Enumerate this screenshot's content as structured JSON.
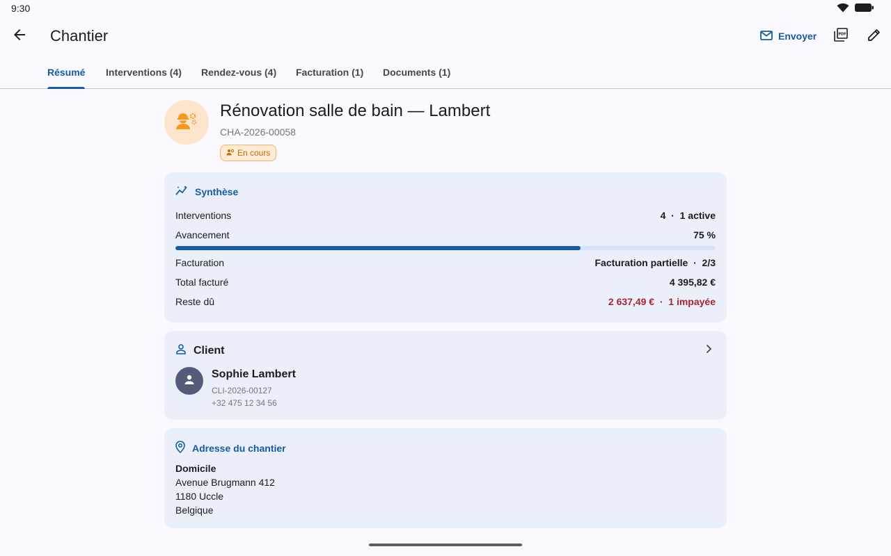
{
  "status_bar": {
    "time": "9:30"
  },
  "app_bar": {
    "title": "Chantier",
    "send_label": "Envoyer",
    "icons": [
      "arrow-back-icon",
      "mail-icon",
      "pdf-icon",
      "edit-icon"
    ]
  },
  "tabs": [
    {
      "label": "Résumé",
      "active": true
    },
    {
      "label": "Interventions (4)",
      "active": false
    },
    {
      "label": "Rendez-vous (4)",
      "active": false
    },
    {
      "label": "Facturation (1)",
      "active": false
    },
    {
      "label": "Documents (1)",
      "active": false
    }
  ],
  "project": {
    "title": "Rénovation salle de bain — Lambert",
    "reference": "CHA-2026-00058",
    "status": "En cours"
  },
  "synthese": {
    "title": "Synthèse",
    "interventions_label": "Interventions",
    "interventions_value": "4  ·  1 active",
    "avancement_label": "Avancement",
    "avancement_value": "75 %",
    "avancement_fraction": 0.75,
    "facturation_label": "Facturation",
    "facturation_value": "Facturation partielle  ·  2/3",
    "total_label": "Total facturé",
    "total_value": "4 395,82 €",
    "reste_label": "Reste dû",
    "reste_value": "2 637,49 €  ·  1 impayée"
  },
  "client": {
    "section_title": "Client",
    "name": "Sophie Lambert",
    "reference": "CLI-2026-00127",
    "phone": "+32 475 12 34 56"
  },
  "adresse": {
    "section_title": "Adresse du chantier",
    "type": "Domicile",
    "street": "Avenue Brugmann 412",
    "city": "1180 Uccle",
    "country": "Belgique"
  },
  "colors": {
    "accent": "#145ca3",
    "danger": "#a8262e",
    "card": "#eaeffa",
    "status_chip": "#fdebd3"
  }
}
